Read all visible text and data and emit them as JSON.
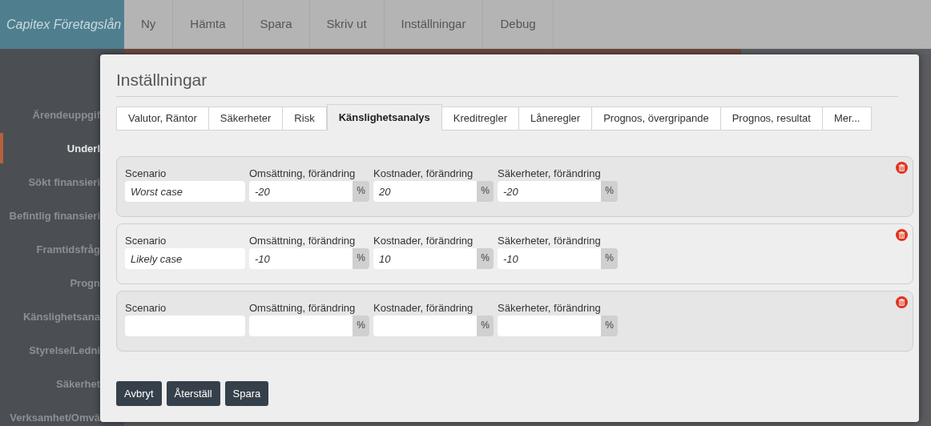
{
  "app": {
    "logo": "Capitex Företagslån"
  },
  "menu": [
    {
      "label": "Ny"
    },
    {
      "label": "Hämta"
    },
    {
      "label": "Spara"
    },
    {
      "label": "Skriv ut"
    },
    {
      "label": "Inställningar"
    },
    {
      "label": "Debug"
    }
  ],
  "sidebar": {
    "items": [
      {
        "label": "Ärendeuppgif",
        "selected": false
      },
      {
        "label": "Underl",
        "selected": true
      },
      {
        "label": "Sökt finansieri",
        "selected": false
      },
      {
        "label": "Befintlig finansieri",
        "selected": false
      },
      {
        "label": "Framtidsfråg",
        "selected": false
      },
      {
        "label": "Progn",
        "selected": false
      },
      {
        "label": "Känslighetsana",
        "selected": false
      },
      {
        "label": "Styrelse/Ledni",
        "selected": false
      },
      {
        "label": "Säkerhet",
        "selected": false
      },
      {
        "label": "Verksamhet/Omvä",
        "selected": false
      }
    ]
  },
  "dialog": {
    "title": "Inställningar",
    "tabs": [
      {
        "label": "Valutor, Räntor",
        "selected": false
      },
      {
        "label": "Säkerheter",
        "selected": false
      },
      {
        "label": "Risk",
        "selected": false
      },
      {
        "label": "Känslighetsanalys",
        "selected": true
      },
      {
        "label": "Kreditregler",
        "selected": false
      },
      {
        "label": "Låneregler",
        "selected": false
      },
      {
        "label": "Prognos, övergripande",
        "selected": false
      },
      {
        "label": "Prognos, resultat",
        "selected": false
      },
      {
        "label": "Mer...",
        "selected": false
      }
    ],
    "scenarios": [
      {
        "fields": [
          {
            "kind": "text",
            "label": "Scenario",
            "value": "Worst case"
          },
          {
            "kind": "percent",
            "label": "Omsättning, förändring",
            "value": "-20",
            "unit": "%"
          },
          {
            "kind": "percent",
            "label": "Kostnader, förändring",
            "value": "20",
            "unit": "%"
          },
          {
            "kind": "percent",
            "label": "Säkerheter, förändring",
            "value": "-20",
            "unit": "%"
          }
        ]
      },
      {
        "fields": [
          {
            "kind": "text",
            "label": "Scenario",
            "value": "Likely case"
          },
          {
            "kind": "percent",
            "label": "Omsättning, förändring",
            "value": "-10",
            "unit": "%"
          },
          {
            "kind": "percent",
            "label": "Kostnader, förändring",
            "value": "10",
            "unit": "%"
          },
          {
            "kind": "percent",
            "label": "Säkerheter, förändring",
            "value": "-10",
            "unit": "%"
          }
        ]
      },
      {
        "fields": [
          {
            "kind": "text",
            "label": "Scenario"
          },
          {
            "kind": "percent",
            "label": "Omsättning, förändring",
            "unit": "%"
          },
          {
            "kind": "percent",
            "label": "Kostnader, förändring",
            "unit": "%"
          },
          {
            "kind": "percent",
            "label": "Säkerheter, förändring",
            "unit": "%"
          }
        ]
      }
    ],
    "buttons": [
      {
        "label": "Avbryt"
      },
      {
        "label": "Återställ"
      },
      {
        "label": "Spara"
      }
    ]
  }
}
